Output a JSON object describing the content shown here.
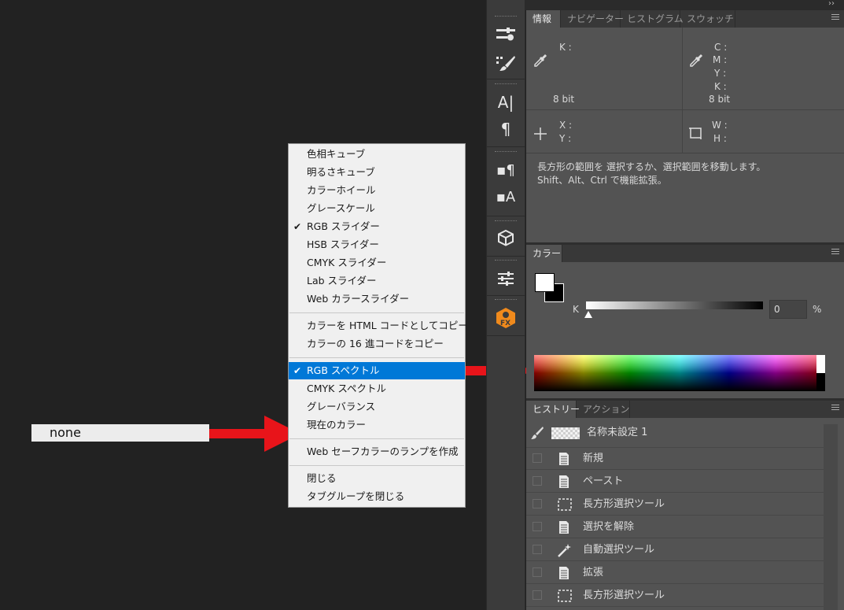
{
  "canvas": {
    "label_text": "none"
  },
  "context_menu": {
    "groups": [
      [
        {
          "label": "色相キューブ",
          "checked": false
        },
        {
          "label": "明るさキューブ",
          "checked": false
        },
        {
          "label": "カラーホイール",
          "checked": false
        },
        {
          "label": "グレースケール",
          "checked": false
        },
        {
          "label": "RGB スライダー",
          "checked": true
        },
        {
          "label": "HSB スライダー",
          "checked": false
        },
        {
          "label": "CMYK スライダー",
          "checked": false
        },
        {
          "label": "Lab スライダー",
          "checked": false
        },
        {
          "label": "Web カラースライダー",
          "checked": false
        }
      ],
      [
        {
          "label": "カラーを HTML コードとしてコピー",
          "checked": false
        },
        {
          "label": "カラーの 16 進コードをコピー",
          "checked": false
        }
      ],
      [
        {
          "label": "RGB スペクトル",
          "checked": true,
          "highlighted": true
        },
        {
          "label": "CMYK スペクトル",
          "checked": false
        },
        {
          "label": "グレーバランス",
          "checked": false
        },
        {
          "label": "現在のカラー",
          "checked": false
        }
      ],
      [
        {
          "label": "Web セーフカラーのランプを作成",
          "checked": false
        }
      ],
      [
        {
          "label": "閉じる",
          "checked": false
        },
        {
          "label": "タブグループを閉じる",
          "checked": false
        }
      ]
    ],
    "check_glyph": "✔"
  },
  "info_panel": {
    "tabs": [
      "情報",
      "ナビゲーター",
      "ヒストグラム",
      "スウォッチ"
    ],
    "k_label": "K :",
    "cmyk_labels": [
      "C :",
      "M :",
      "Y :",
      "K :"
    ],
    "bit_left": "8 bit",
    "bit_right": "8 bit",
    "xy_labels": [
      "X :",
      "Y :"
    ],
    "wh_labels": [
      "W :",
      "H :"
    ],
    "help_line1": "長方形の範囲を 選択するか、選択範囲を移動します。",
    "help_line2": "Shift、Alt、Ctrl で機能拡張。"
  },
  "color_panel": {
    "tab": "カラー",
    "slider_label": "K",
    "value": "0",
    "unit": "%",
    "slider_level": 0,
    "foreground": "#ffffff",
    "background": "#000000"
  },
  "history_panel": {
    "tabs": [
      "ヒストリー",
      "アクション"
    ],
    "snapshot": "名称未設定 1",
    "items": [
      {
        "label": "新規",
        "icon": "document-icon"
      },
      {
        "label": "ペースト",
        "icon": "document-icon"
      },
      {
        "label": "長方形選択ツール",
        "icon": "marquee-icon"
      },
      {
        "label": "選択を解除",
        "icon": "document-icon"
      },
      {
        "label": "自動選択ツール",
        "icon": "magic-wand-icon"
      },
      {
        "label": "拡張",
        "icon": "document-icon"
      },
      {
        "label": "長方形選択ツール",
        "icon": "marquee-icon"
      }
    ]
  },
  "toolbar_icons": [
    "properties-icon",
    "brush-settings-icon",
    "character-icon",
    "paragraph-icon",
    "paragraph-styles-icon",
    "character-styles-icon",
    "3d-icon",
    "adjustments-icon",
    "fx-plugin-icon"
  ],
  "colors": {
    "highlight": "#0078d7",
    "arrow": "#e8141a",
    "panel": "#535353"
  }
}
